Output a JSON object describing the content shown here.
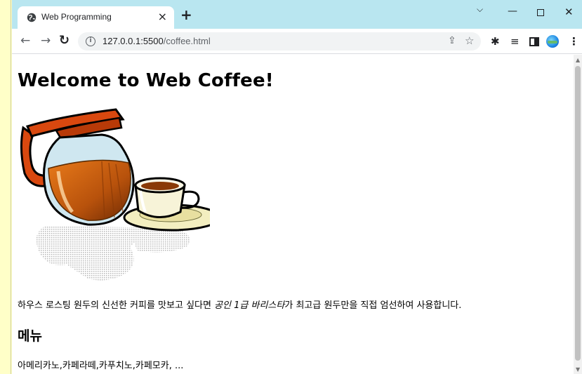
{
  "browser": {
    "tab_title": "Web Programming",
    "tab_close": "×",
    "new_tab": "+",
    "url_host": "127.0.0.1:5500",
    "url_path": "/coffee.html"
  },
  "page": {
    "title": "Welcome to Web Coffee!",
    "intro_before": "하우스 로스팅 원두의 신선한 커피를 맛보고 싶다면 ",
    "intro_em": "공인 1급 바리스타",
    "intro_after": "가 최고급 원두만을 직접 엄선하여 사용합니다.",
    "menu_heading": "메뉴",
    "menu_items": "아메리카노,카페라떼,카푸치노,카페모카, ..."
  },
  "colors": {
    "titlebar": "#b9e6f0",
    "side_strip": "#ffffc8"
  }
}
